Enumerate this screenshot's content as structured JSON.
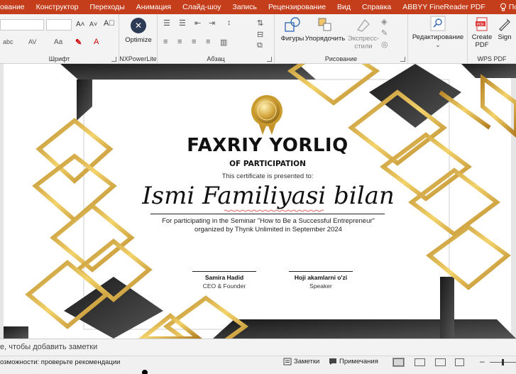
{
  "menu": {
    "items": [
      "ование",
      "Конструктор",
      "Переходы",
      "Анимация",
      "Слайд-шоу",
      "Запись",
      "Рецензирование",
      "Вид",
      "Справка",
      "ABBYY FineReader PDF"
    ],
    "help_label": "Помощ"
  },
  "ribbon": {
    "font_group_label": "Шрифт",
    "font_abc": "abc",
    "font_av": "AV",
    "font_aa": "Aa",
    "nx_group_label": "NXPowerLite",
    "nx_optimize": "Optimize",
    "paragraph_group_label": "Абзац",
    "drawing_group_label": "Рисование",
    "shapes_label": "Фигуры",
    "arrange_label": "Упорядочить",
    "express_label": "Экспресс-\nстили",
    "editing_label": "Редактирование",
    "create_pdf_label": "Create\nPDF",
    "sign_label": "Sign",
    "wps_group_label": "WPS PDF"
  },
  "certificate": {
    "title": "FAXRIY YORLIQ",
    "subtitle": "OF PARTICIPATION",
    "presented": "This certificate is presented to:",
    "name": "Ismi Familiyasi bilan",
    "desc_line1": "For participating in the Seminar \"How to Be a Successful Entrepreneur\"",
    "desc_line2": "organized by Thynk Unlimited in September 2024",
    "sig1_name": "Samira Hadid",
    "sig1_role": "CEO & Founder",
    "sig2_name": "Hoji akamlarni o'zi",
    "sig2_role": "Speaker"
  },
  "notes": {
    "placeholder": "е, чтобы добавить заметки"
  },
  "status": {
    "accessibility": "озможности: проверьте рекомендации",
    "notes_btn": "Заметки",
    "comments_btn": "Примечания"
  },
  "colors": {
    "accent": "#c43e1c",
    "gold": "#d4a52a",
    "dark": "#2b2b2b"
  }
}
